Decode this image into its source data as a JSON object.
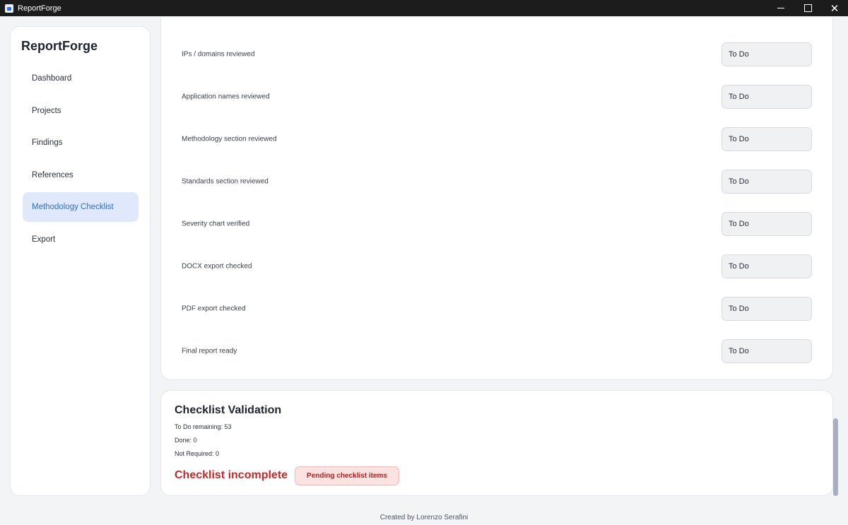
{
  "window": {
    "title": "ReportForge",
    "controls": {
      "minimize": "",
      "maximize": "",
      "close": "✕"
    }
  },
  "sidebar": {
    "brand": "ReportForge",
    "items": [
      {
        "label": "Dashboard",
        "active": false
      },
      {
        "label": "Projects",
        "active": false
      },
      {
        "label": "Findings",
        "active": false
      },
      {
        "label": "References",
        "active": false
      },
      {
        "label": "Methodology Checklist",
        "active": true
      },
      {
        "label": "Export",
        "active": false
      }
    ]
  },
  "checklist": {
    "items": [
      {
        "label": "IPs / domains reviewed",
        "status": "To Do"
      },
      {
        "label": "Application names reviewed",
        "status": "To Do"
      },
      {
        "label": "Methodology section reviewed",
        "status": "To Do"
      },
      {
        "label": "Standards section reviewed",
        "status": "To Do"
      },
      {
        "label": "Severity chart verified",
        "status": "To Do"
      },
      {
        "label": "DOCX export checked",
        "status": "To Do"
      },
      {
        "label": "PDF export checked",
        "status": "To Do"
      },
      {
        "label": "Final report ready",
        "status": "To Do"
      }
    ]
  },
  "validation": {
    "title": "Checklist Validation",
    "todo_remaining": "To Do remaining: 53",
    "done": "Done: 0",
    "not_required": "Not Required: 0",
    "status": "Checklist incomplete",
    "badge": "Pending checklist items"
  },
  "footer": {
    "credit": "Created by Lorenzo Serafini"
  },
  "colors": {
    "accent": "#2f6fd6",
    "active_nav_bg": "#dfe9fb",
    "error": "#c62828",
    "badge_bg": "#fde2e2"
  }
}
